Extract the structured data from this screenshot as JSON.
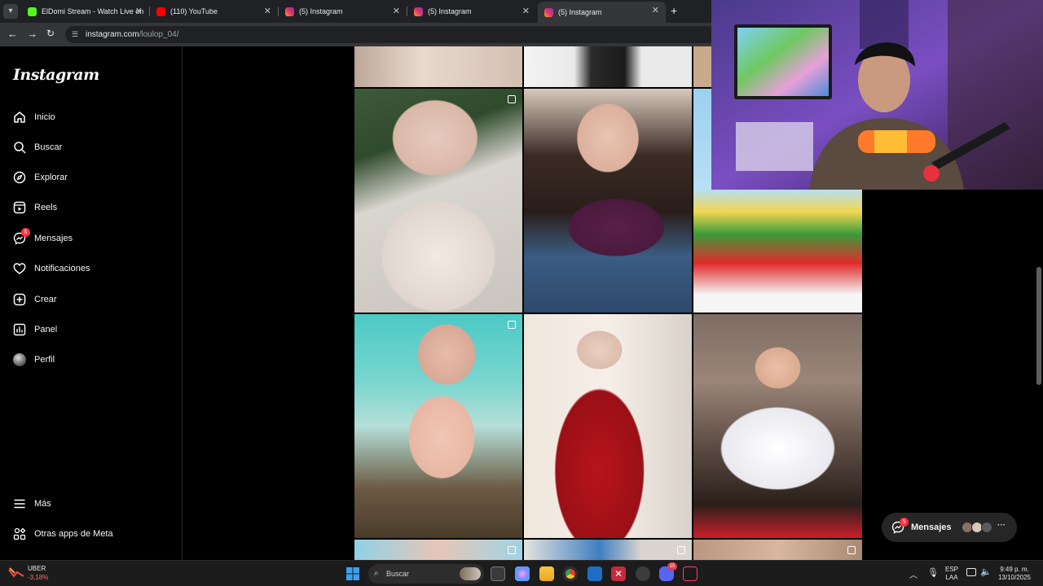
{
  "browser": {
    "tabs": [
      {
        "title": "ElDomi Stream - Watch Live on",
        "icon_color": "#53fc18",
        "icon": "kick-icon"
      },
      {
        "title": "(110) YouTube",
        "icon_color": "#ff0000",
        "icon": "youtube-icon"
      },
      {
        "title": "(5) Instagram",
        "icon_color": "#e1306c",
        "icon": "instagram-icon"
      },
      {
        "title": "(5) Instagram",
        "icon_color": "#e1306c",
        "icon": "instagram-icon"
      },
      {
        "title": "(5) Instagram",
        "icon_color": "#e1306c",
        "icon": "instagram-icon",
        "active": true
      }
    ],
    "new_tab": "+",
    "url_host": "instagram.com",
    "url_path": "/loulop_04/"
  },
  "sidebar": {
    "logo": "Instagram",
    "items": [
      {
        "label": "Inicio",
        "icon": "home-icon"
      },
      {
        "label": "Buscar",
        "icon": "search-icon"
      },
      {
        "label": "Explorar",
        "icon": "compass-icon"
      },
      {
        "label": "Reels",
        "icon": "reels-icon"
      },
      {
        "label": "Mensajes",
        "icon": "messenger-icon",
        "badge": "5"
      },
      {
        "label": "Notificaciones",
        "icon": "heart-icon"
      },
      {
        "label": "Crear",
        "icon": "plus-square-icon"
      },
      {
        "label": "Panel",
        "icon": "chart-icon"
      },
      {
        "label": "Perfil",
        "icon": "avatar-icon"
      }
    ],
    "bottom_items": [
      {
        "label": "Más",
        "icon": "menu-icon"
      },
      {
        "label": "Otras apps de Meta",
        "icon": "apps-icon"
      }
    ]
  },
  "messages_pill": {
    "label": "Mensajes",
    "badge": "5",
    "more": "···"
  },
  "taskbar": {
    "stock_name": "UBER",
    "stock_change": "-3,18%",
    "search_placeholder": "Buscar",
    "lang_top": "ESP",
    "lang_bottom": "LAA",
    "time": "9:49 p. m.",
    "date": "13/10/2025",
    "discord_badge": "15"
  },
  "colors": {
    "accent": "#ff3040",
    "background": "#000000",
    "sidebar_border": "#262626"
  }
}
